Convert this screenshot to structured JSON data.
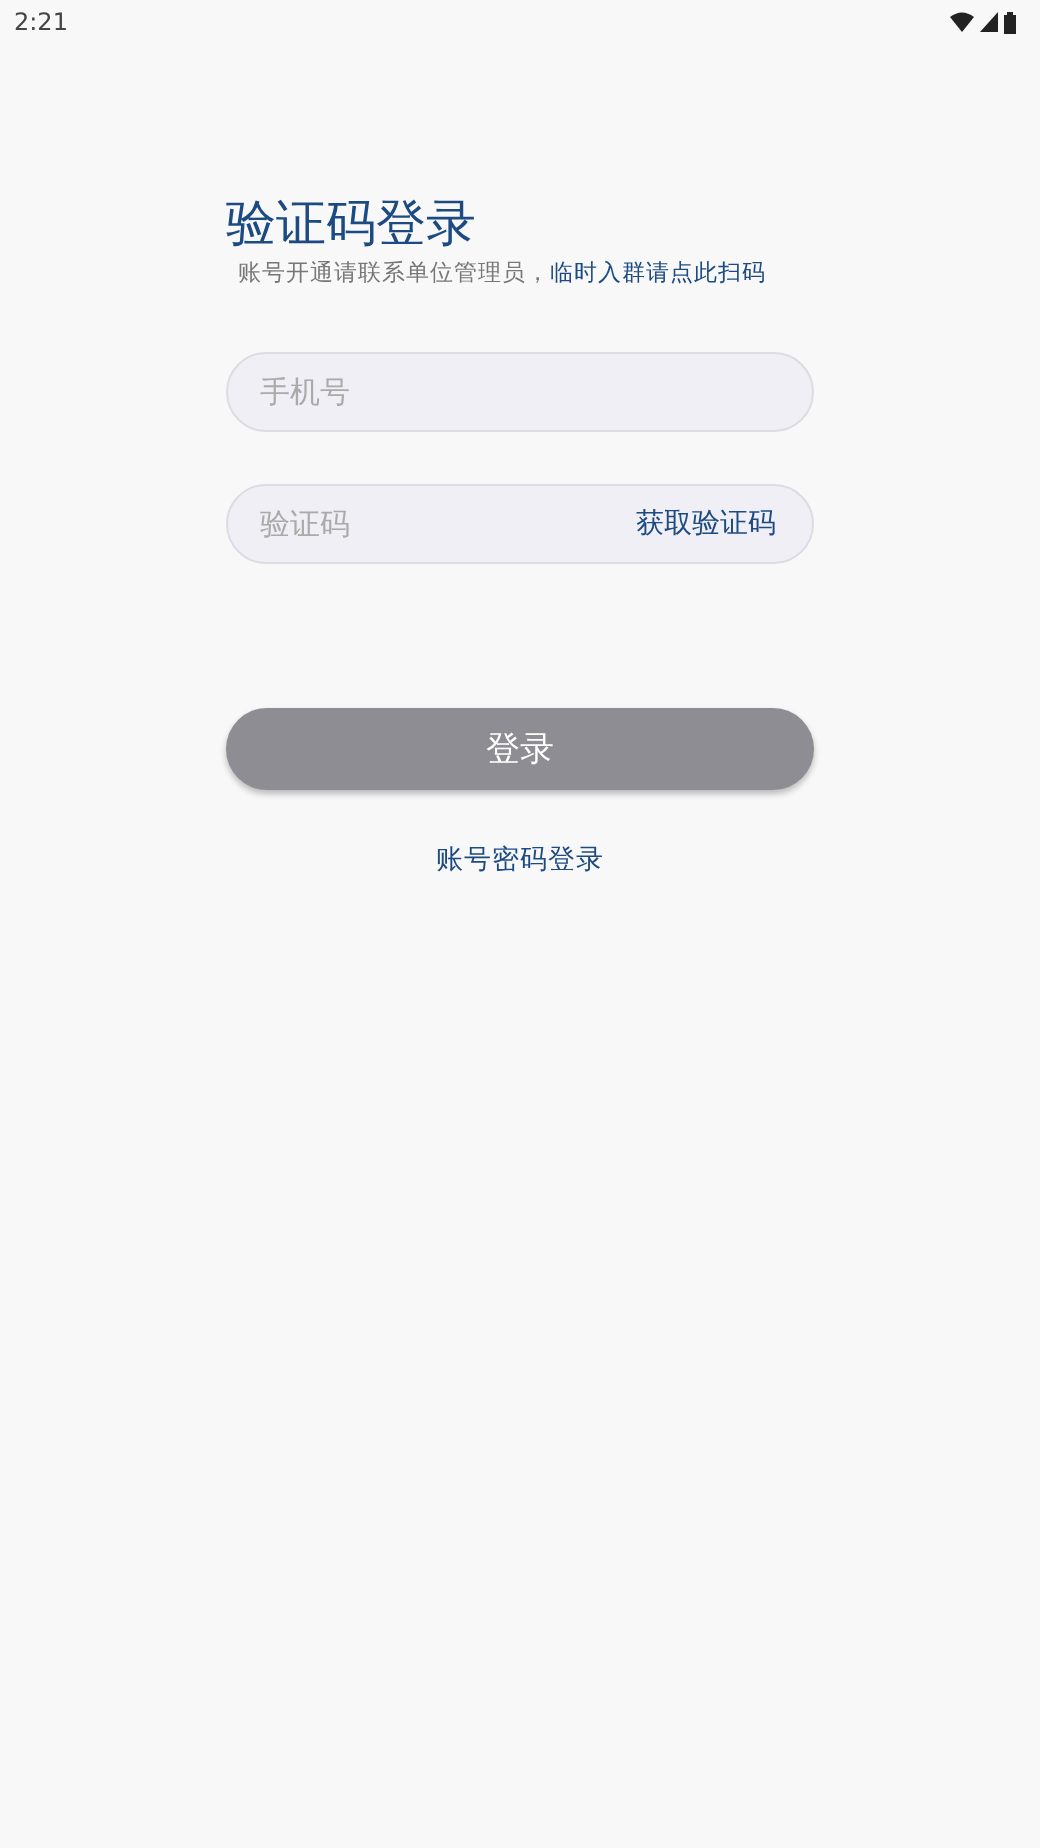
{
  "status_bar": {
    "time": "2:21"
  },
  "title": "验证码登录",
  "subtitle": {
    "text": "账号开通请联系单位管理员，",
    "link": "临时入群请点此扫码"
  },
  "phone_field": {
    "placeholder": "手机号"
  },
  "code_field": {
    "placeholder": "验证码",
    "action": "获取验证码"
  },
  "login_button": {
    "label": "登录",
    "disabled": true
  },
  "alt_login_link": "账号密码登录"
}
